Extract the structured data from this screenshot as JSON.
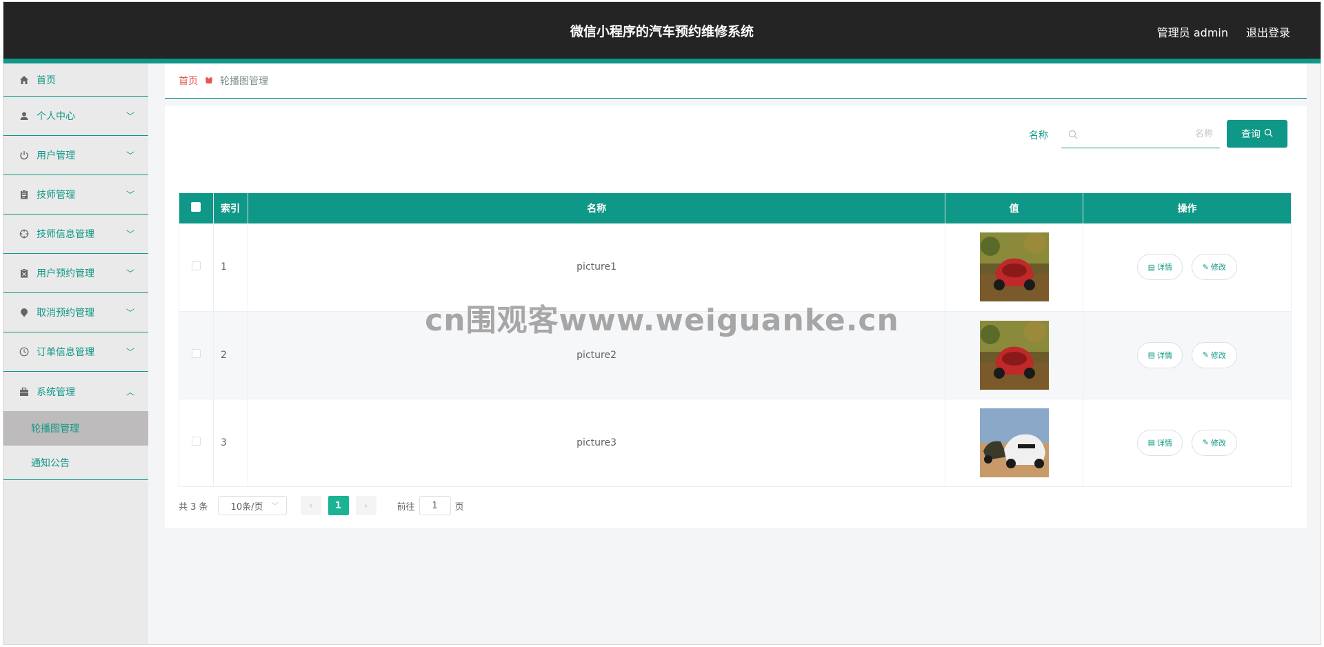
{
  "header": {
    "title": "微信小程序的汽车预约维修系统",
    "user": "管理员 admin",
    "logout": "退出登录"
  },
  "sidebar": {
    "items": [
      {
        "label": "首页",
        "icon": "home-icon"
      },
      {
        "label": "个人中心",
        "icon": "user-icon"
      },
      {
        "label": "用户管理",
        "icon": "power-icon"
      },
      {
        "label": "技师管理",
        "icon": "clipboard-icon"
      },
      {
        "label": "技师信息管理",
        "icon": "crosshair-icon"
      },
      {
        "label": "用户预约管理",
        "icon": "document-x-icon"
      },
      {
        "label": "取消预约管理",
        "icon": "pin-icon"
      },
      {
        "label": "订单信息管理",
        "icon": "clock-icon"
      },
      {
        "label": "系统管理",
        "icon": "briefcase-icon"
      }
    ],
    "submenu": [
      {
        "label": "轮播图管理",
        "active": true
      },
      {
        "label": "通知公告",
        "active": false
      }
    ]
  },
  "breadcrumb": {
    "home": "首页",
    "current": "轮播图管理"
  },
  "search": {
    "label": "名称",
    "placeholder": "名称",
    "button": "查询"
  },
  "table": {
    "headers": {
      "index": "索引",
      "name": "名称",
      "value": "值",
      "actions": "操作"
    },
    "rows": [
      {
        "index": "1",
        "name": "picture1",
        "image": "red-race-car"
      },
      {
        "index": "2",
        "name": "picture2",
        "image": "red-race-car"
      },
      {
        "index": "3",
        "name": "picture3",
        "image": "white-race-cars"
      }
    ],
    "detail_label": "详情",
    "edit_label": "修改"
  },
  "pagination": {
    "total": "共 3 条",
    "page_size": "10条/页",
    "current_page": "1",
    "goto_prefix": "前往",
    "goto_value": "1",
    "goto_suffix": "页"
  },
  "watermark": "cn围观客www.weiguanke.cn",
  "colors": {
    "primary": "#0f9787",
    "header_bg": "#242424",
    "pager_active": "#1ab394",
    "crumb_home": "#e8554e"
  }
}
